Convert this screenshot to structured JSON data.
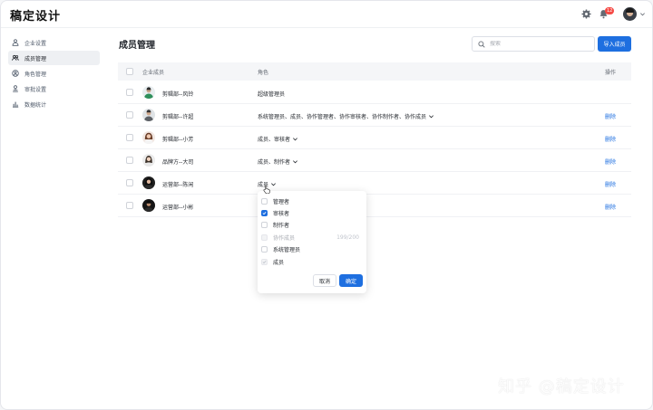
{
  "app": {
    "logo": "稿定设计"
  },
  "header": {
    "notification_count": "12"
  },
  "sidebar": {
    "items": [
      {
        "label": "企业设置",
        "icon": "enterprise-icon"
      },
      {
        "label": "成员管理",
        "icon": "members-icon",
        "active": true
      },
      {
        "label": "角色管理",
        "icon": "role-icon"
      },
      {
        "label": "审批设置",
        "icon": "approval-icon"
      },
      {
        "label": "数据统计",
        "icon": "stats-icon"
      }
    ]
  },
  "main": {
    "title": "成员管理",
    "search": {
      "placeholder": "搜索"
    },
    "import_label": "导入成员",
    "table": {
      "headers": {
        "member": "企业成员",
        "role": "角色",
        "action": "操作"
      },
      "rows": [
        {
          "name": "剪辑部--风铃",
          "role": "超级管理员",
          "dropdown": false,
          "action": ""
        },
        {
          "name": "剪辑部--许超",
          "role": "系统管理员、成员、协作管理者、协作审核者、协作制作者、协作成员",
          "dropdown": true,
          "action": "删除"
        },
        {
          "name": "剪辑部--小芳",
          "role": "成员、审核者",
          "dropdown": true,
          "action": "删除"
        },
        {
          "name": "品牌方--大司",
          "role": "成员、制作者",
          "dropdown": true,
          "action": "删除"
        },
        {
          "name": "运营部--陈闲",
          "role": "成员",
          "dropdown": true,
          "action": "删除"
        },
        {
          "name": "运营部--小彬",
          "role": "",
          "dropdown": false,
          "action": "删除"
        }
      ]
    }
  },
  "role_dropdown": {
    "options": [
      {
        "label": "管理者",
        "checked": false,
        "disabled": false,
        "count": ""
      },
      {
        "label": "审核者",
        "checked": true,
        "disabled": false,
        "count": ""
      },
      {
        "label": "制作者",
        "checked": false,
        "disabled": false,
        "count": ""
      },
      {
        "label": "协作成员",
        "checked": false,
        "disabled": true,
        "count": "199/200"
      },
      {
        "label": "系统管理员",
        "checked": false,
        "disabled": false,
        "count": ""
      },
      {
        "label": "成员",
        "checked": true,
        "disabled": true,
        "count": ""
      }
    ],
    "cancel_label": "取消",
    "confirm_label": "确定"
  },
  "watermark": "知乎 @稿定设计",
  "colors": {
    "primary": "#1e6fe0",
    "badge": "#f54a45"
  }
}
